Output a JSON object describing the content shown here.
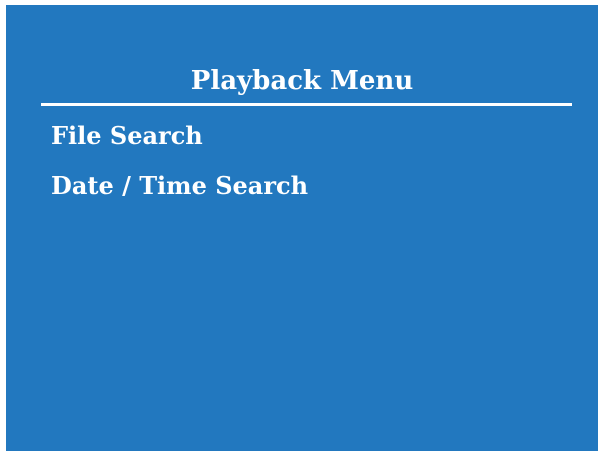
{
  "menu": {
    "title": "Playback Menu",
    "items": [
      {
        "label": "File Search"
      },
      {
        "label": "Date / Time Search"
      }
    ]
  },
  "colors": {
    "background": "#2278bf",
    "text": "#ffffff",
    "divider": "#ffffff",
    "frame": "#ffffff"
  }
}
